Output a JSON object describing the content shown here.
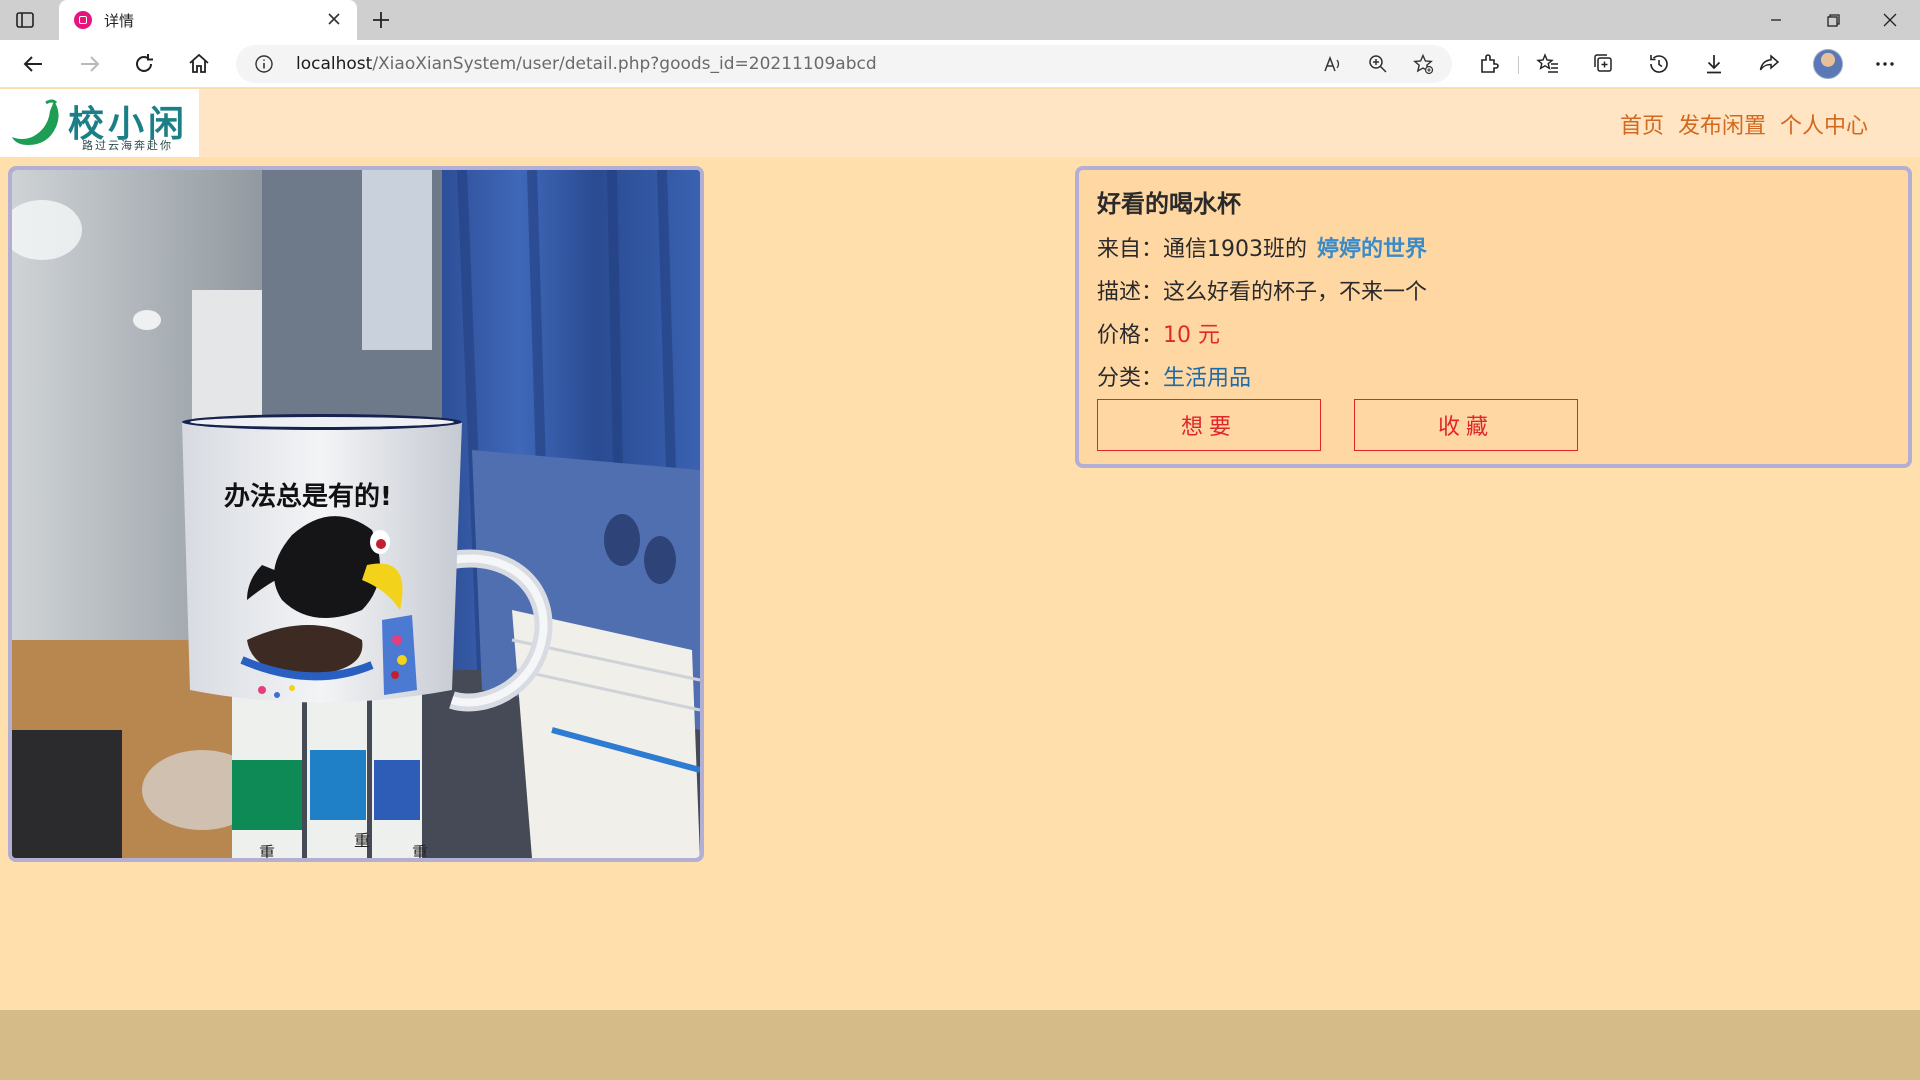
{
  "browser": {
    "tab_title": "详情",
    "url_host": "localhost",
    "url_path": "/XiaoXianSystem/user/detail.php?goods_id=20211109abcd"
  },
  "site": {
    "logo_text": "校小闲",
    "logo_slogan": "路过云海奔赴你",
    "nav": [
      "首页",
      "发布闲置",
      "个人中心"
    ]
  },
  "product": {
    "title": "好看的喝水杯",
    "from_label": "来自：",
    "from_class": "通信1903班的",
    "seller": "婷婷的世界",
    "desc_label": "描述：",
    "desc": "这么好看的杯子，不来一个",
    "price_label": "价格：",
    "price": "10 元",
    "category_label": "分类：",
    "category": "生活用品",
    "want_button": "想要",
    "collect_button": "收藏",
    "image": {
      "mug_text": "办法总是有的!",
      "book_label": "重"
    }
  }
}
